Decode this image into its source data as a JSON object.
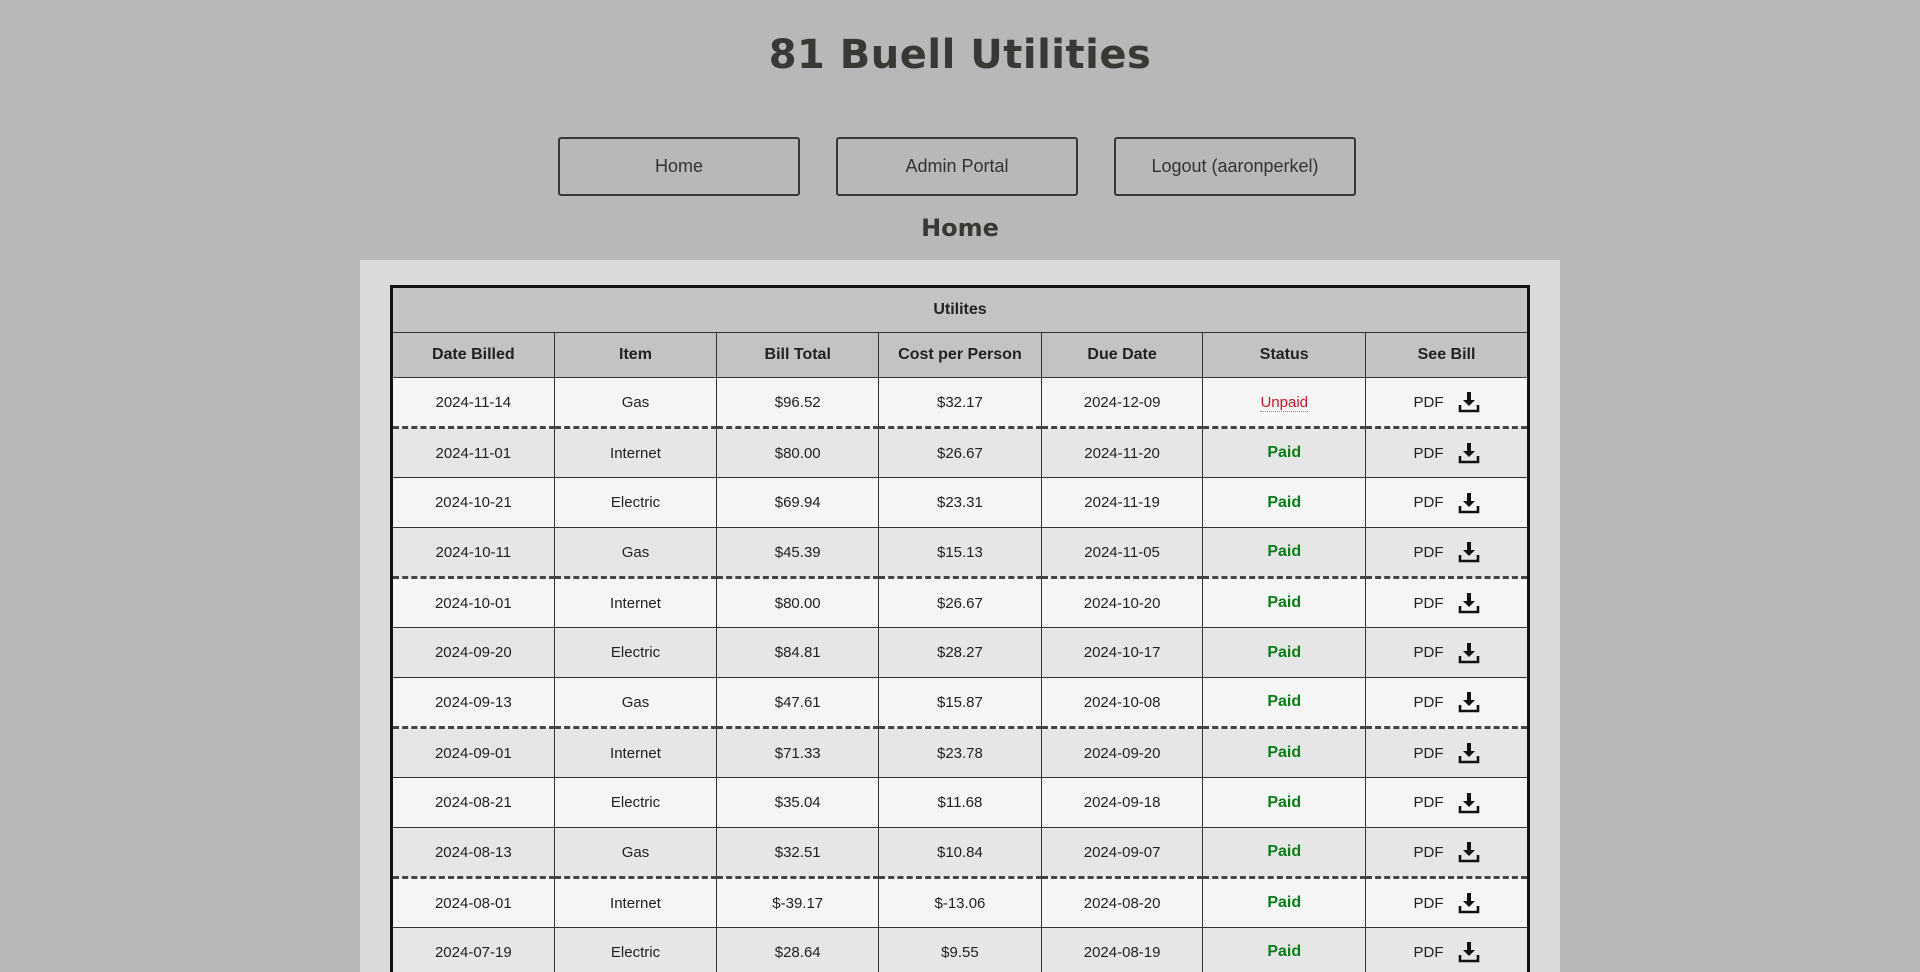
{
  "site": {
    "title": "81 Buell Utilities"
  },
  "nav": {
    "home": "Home",
    "admin": "Admin Portal",
    "logout": "Logout (aaronperkel)"
  },
  "section_heading": "Home",
  "table": {
    "caption": "Utilites",
    "headers": [
      "Date Billed",
      "Item",
      "Bill Total",
      "Cost per Person",
      "Due Date",
      "Status",
      "See Bill"
    ],
    "pdf_label": "PDF",
    "rows": [
      {
        "date": "2024-11-14",
        "item": "Gas",
        "total": "$96.52",
        "per": "$32.17",
        "due": "2024-12-09",
        "status": "Unpaid"
      },
      {
        "date": "2024-11-01",
        "item": "Internet",
        "total": "$80.00",
        "per": "$26.67",
        "due": "2024-11-20",
        "status": "Paid"
      },
      {
        "date": "2024-10-21",
        "item": "Electric",
        "total": "$69.94",
        "per": "$23.31",
        "due": "2024-11-19",
        "status": "Paid"
      },
      {
        "date": "2024-10-11",
        "item": "Gas",
        "total": "$45.39",
        "per": "$15.13",
        "due": "2024-11-05",
        "status": "Paid"
      },
      {
        "date": "2024-10-01",
        "item": "Internet",
        "total": "$80.00",
        "per": "$26.67",
        "due": "2024-10-20",
        "status": "Paid"
      },
      {
        "date": "2024-09-20",
        "item": "Electric",
        "total": "$84.81",
        "per": "$28.27",
        "due": "2024-10-17",
        "status": "Paid"
      },
      {
        "date": "2024-09-13",
        "item": "Gas",
        "total": "$47.61",
        "per": "$15.87",
        "due": "2024-10-08",
        "status": "Paid"
      },
      {
        "date": "2024-09-01",
        "item": "Internet",
        "total": "$71.33",
        "per": "$23.78",
        "due": "2024-09-20",
        "status": "Paid"
      },
      {
        "date": "2024-08-21",
        "item": "Electric",
        "total": "$35.04",
        "per": "$11.68",
        "due": "2024-09-18",
        "status": "Paid"
      },
      {
        "date": "2024-08-13",
        "item": "Gas",
        "total": "$32.51",
        "per": "$10.84",
        "due": "2024-09-07",
        "status": "Paid"
      },
      {
        "date": "2024-08-01",
        "item": "Internet",
        "total": "$-39.17",
        "per": "$-13.06",
        "due": "2024-08-20",
        "status": "Paid"
      },
      {
        "date": "2024-07-19",
        "item": "Electric",
        "total": "$28.64",
        "per": "$9.55",
        "due": "2024-08-19",
        "status": "Paid"
      }
    ]
  },
  "colors": {
    "background": "#b9b7b8",
    "paid": "#0a7a1a",
    "unpaid": "#d0142a"
  },
  "icons": {
    "download": "download-icon"
  }
}
